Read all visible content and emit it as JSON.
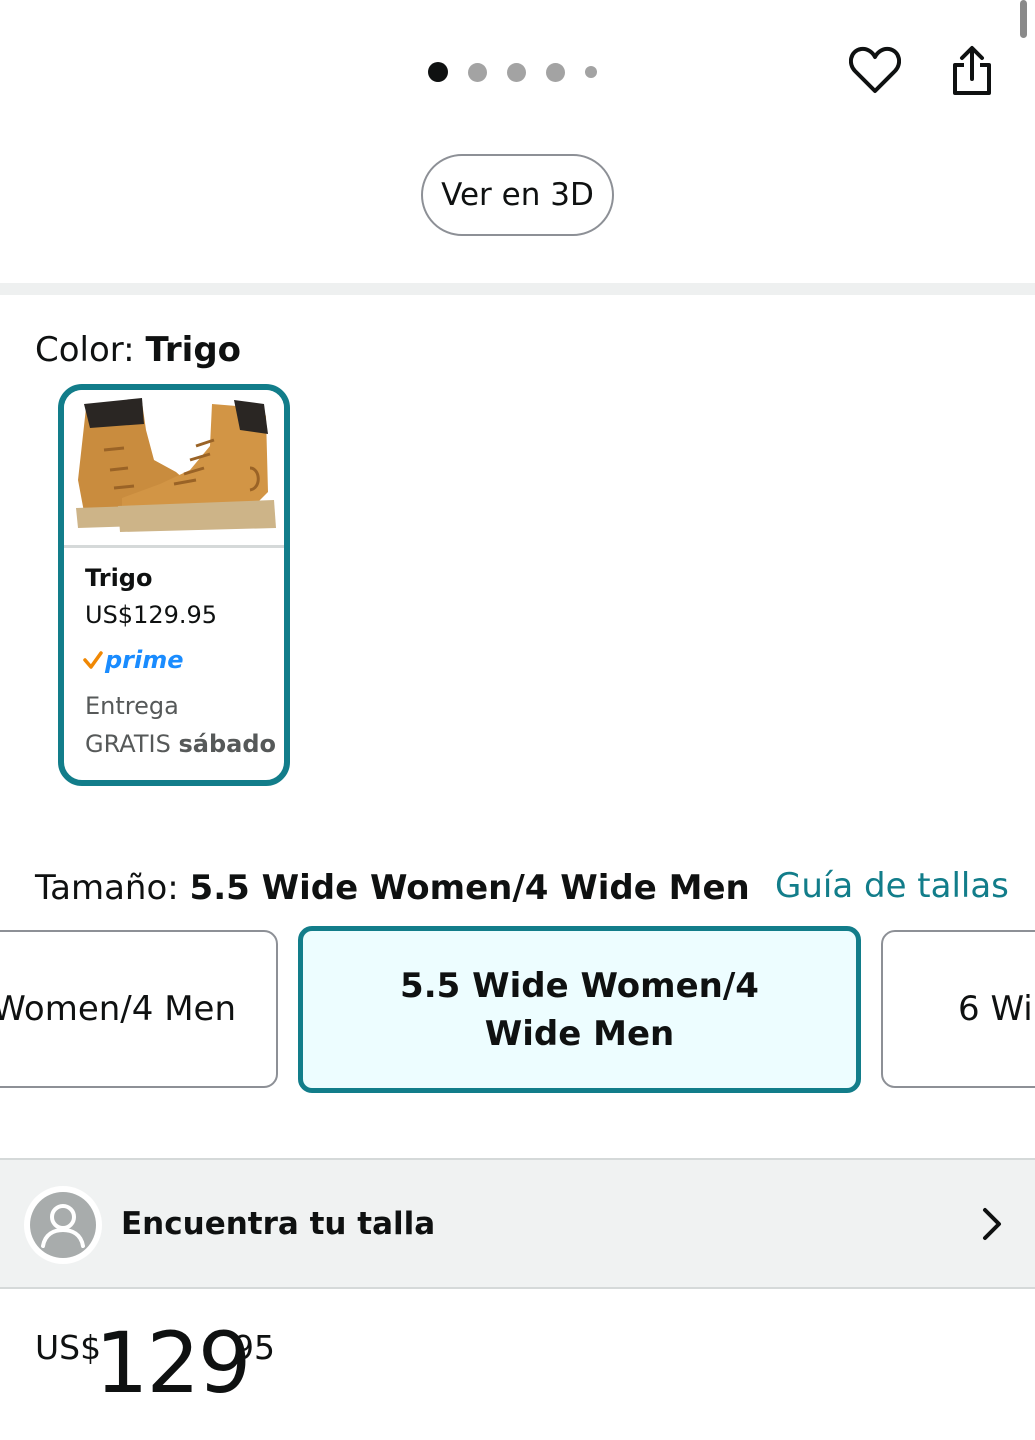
{
  "gallery": {
    "dot_count": 5,
    "active_index": 0,
    "view_3d_label": "Ver en 3D"
  },
  "icons": {
    "favorite": "heart-icon",
    "share": "share-icon",
    "prime_check": "check-icon",
    "avatar": "user-icon",
    "chevron": "chevron-right-icon"
  },
  "color": {
    "label": "Color: ",
    "selected": "Trigo",
    "swatch": {
      "name": "Trigo",
      "price": "US$129.95",
      "prime_label": "prime",
      "delivery_line1": "Entrega",
      "delivery_free": "GRATIS ",
      "delivery_day": "sábado"
    }
  },
  "size": {
    "label": "Tamaño: ",
    "selected": "5.5 Wide Women/4 Wide Men",
    "guide_link": "Guía de tallas",
    "options": [
      {
        "label": "Women/4 Men"
      },
      {
        "label": "5.5 Wide Women/4 Wide Men"
      },
      {
        "label": "6 Wi"
      }
    ]
  },
  "fit_finder": {
    "label": "Encuentra tu talla"
  },
  "price": {
    "currency": "US$",
    "whole": "129",
    "fraction": "95"
  },
  "colors": {
    "accent_teal": "#127d8a",
    "selected_bg": "#edfdff",
    "link": "#127d8a",
    "prime_blue": "#1a8cff",
    "prime_check": "#f08804"
  }
}
